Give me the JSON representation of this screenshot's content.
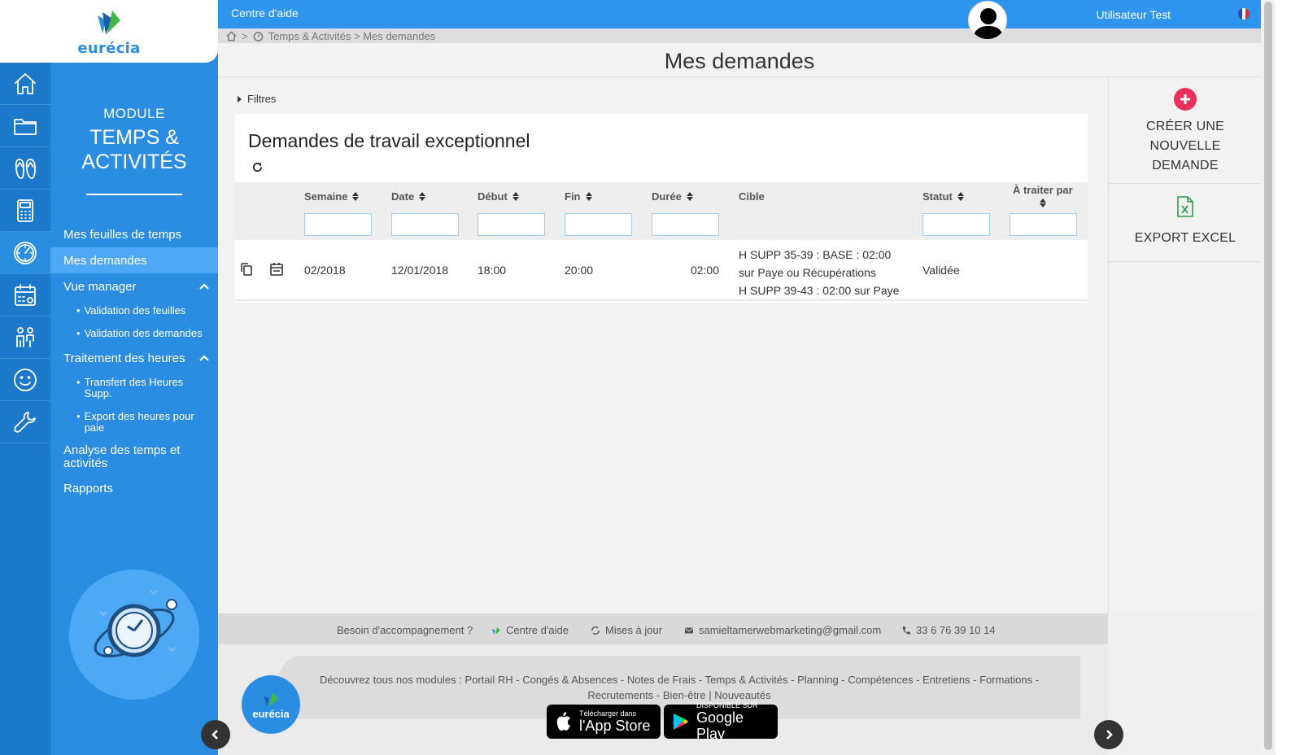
{
  "brand": {
    "logo_text": "eurécia"
  },
  "topbar": {
    "help_label": "Centre d'aide",
    "user_name": "Utilisateur  Test"
  },
  "breadcrumb": {
    "separator": ">",
    "path": "Temps & Activités > Mes demandes"
  },
  "page_title": "Mes demandes",
  "sidebar": {
    "module_label": "MODULE",
    "module_name_line1": "TEMPS &",
    "module_name_line2": "ACTIVITÉS",
    "items": [
      {
        "label": "Mes feuilles de temps"
      },
      {
        "label": "Mes demandes"
      },
      {
        "label": "Vue manager"
      },
      {
        "label": "Validation des feuilles"
      },
      {
        "label": "Validation des demandes"
      },
      {
        "label": "Traitement des heures"
      },
      {
        "label": "Transfert des Heures Supp."
      },
      {
        "label": "Export des heures pour paie"
      },
      {
        "label": "Analyse des temps et activités"
      },
      {
        "label": "Rapports"
      }
    ],
    "bullet": "•"
  },
  "rail_icons": [
    "home-icon",
    "folder-icon",
    "flip-flops-icon",
    "calculator-icon",
    "stopwatch-icon",
    "calendar-icon",
    "people-icon",
    "smiley-icon",
    "wrench-icon"
  ],
  "filters_label": "Filtres",
  "card": {
    "title": "Demandes de travail exceptionnel",
    "columns": [
      "Semaine",
      "Date",
      "Début",
      "Fin",
      "Durée",
      "Cible",
      "Statut",
      "À traiter par"
    ],
    "rows": [
      {
        "semaine": "02/2018",
        "date": "12/01/2018",
        "debut": "18:00",
        "fin": "20:00",
        "duree": "02:00",
        "cible_line1": "H SUPP 35-39 : BASE : 02:00",
        "cible_line2": "sur Paye ou Récupérations",
        "cible_line3": "H SUPP 39-43 : 02:00 sur Paye",
        "statut": "Validée",
        "a_traiter_par": ""
      }
    ]
  },
  "actions": {
    "create_line1": "CRÉER UNE",
    "create_line2": "NOUVELLE",
    "create_line3": "DEMANDE",
    "export_label": "EXPORT EXCEL"
  },
  "footer": {
    "help_question": "Besoin d'accompagnement ?",
    "help_center": "Centre d'aide",
    "updates": "Mises à jour",
    "email": "samieltamerwebmarketing@gmail.com",
    "phone": "33 6 76 39 10 14",
    "modules_line1": "Découvrez tous nos modules : Portail RH - Congés & Absences - Notes de Frais - Temps & Activités - Planning - Compétences - Entretiens - Formations -",
    "modules_line2": "Recrutements - Bien-être   |   Nouveautés",
    "logo_text": "eurécia",
    "appstore_small": "Télécharger dans",
    "appstore_big": "l'App Store",
    "play_small": "DISPONIBLE SUR",
    "play_big": "Google Play"
  },
  "colors": {
    "primary": "#2b8de2",
    "rail": "#1c79c9",
    "accent": "#e8305a",
    "excel": "#2e9e4a"
  }
}
